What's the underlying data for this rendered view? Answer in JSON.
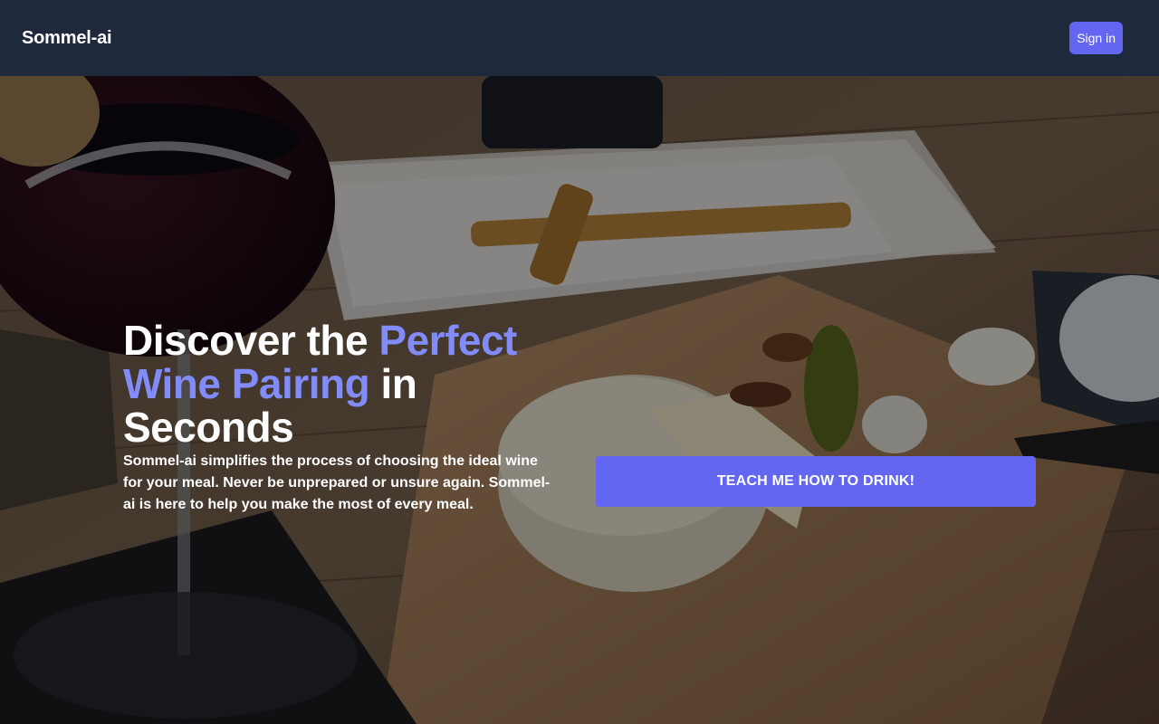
{
  "nav": {
    "brand": "Sommel-ai",
    "signin_label": "Sign in"
  },
  "hero": {
    "headline_part1": "Discover the ",
    "headline_accent": "Perfect Wine Pairing",
    "headline_part2": " in Seconds",
    "description": "Sommel-ai simplifies the process of choosing the ideal wine for your meal. Never be unprepared or unsure again. Sommel-ai is here to help you make the most of every meal.",
    "cta_label": "TEACH ME HOW TO DRINK!"
  },
  "colors": {
    "nav_background": "#1e293b",
    "accent": "#6366f1",
    "accent_text": "#818cf8"
  }
}
